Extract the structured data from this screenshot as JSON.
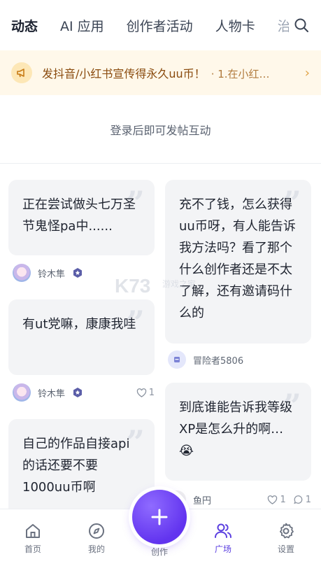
{
  "tabs": [
    {
      "label": "动态",
      "active": true
    },
    {
      "label": "AI 应用",
      "active": false
    },
    {
      "label": "创作者活动",
      "active": false
    },
    {
      "label": "人物卡",
      "active": false
    },
    {
      "label": "治",
      "active": false
    }
  ],
  "icons": {
    "search": "search-icon",
    "notice": "megaphone-icon",
    "arrow": "chevron-right-icon"
  },
  "notice": {
    "title": "发抖音/小红书宣传得永久uu币！",
    "preview": "· 1.在小红…"
  },
  "login_tip": "登录后即可发帖互动",
  "posts": [
    {
      "text": "正在尝试做头七万圣节鬼怪pa中......",
      "author": "铃木隼",
      "likes": ""
    },
    {
      "text": "有ut党嘛，康康我哇",
      "author": "铃木隼",
      "likes": "1"
    },
    {
      "text": "自己的作品自接api的话还要不要1000uu币啊",
      "author": "",
      "likes": ""
    },
    {
      "text": "充不了钱，怎么获得uu币呀，有人能告诉我方法吗？看了那个什么创作者还是不太了解，还有邀请码什么的",
      "author": "冒险者5806",
      "likes": ""
    },
    {
      "text": "到底谁能告诉我等级XP是怎么升的啊…😭",
      "author": "鱼円",
      "likes": "1",
      "comments": "1"
    }
  ],
  "nav": {
    "home": "首页",
    "mine": "我的",
    "create": "创作",
    "square": "广场",
    "settings": "设置"
  },
  "watermark": "K73 游戏之家",
  "colors": {
    "accent": "#5b3fe0",
    "notice_bg": "#fff8ea",
    "card_bg": "#f3f4f6"
  }
}
